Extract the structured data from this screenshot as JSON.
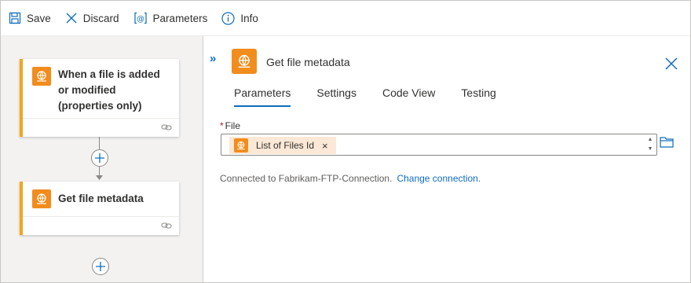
{
  "toolbar": {
    "save_label": "Save",
    "discard_label": "Discard",
    "parameters_label": "Parameters",
    "info_label": "Info"
  },
  "canvas": {
    "trigger_card": {
      "title": "When a file is added or modified (properties only)"
    },
    "action_card": {
      "title": "Get file metadata"
    }
  },
  "panel": {
    "title": "Get file metadata",
    "tabs": [
      {
        "label": "Parameters",
        "active": true
      },
      {
        "label": "Settings",
        "active": false
      },
      {
        "label": "Code View",
        "active": false
      },
      {
        "label": "Testing",
        "active": false
      }
    ],
    "file_field": {
      "label": "File",
      "required_marker": "*",
      "token": "List of Files Id",
      "token_remove": "×"
    },
    "connection": {
      "text": "Connected to Fabrikam-FTP-Connection.",
      "change_link": "Change connection."
    }
  },
  "colors": {
    "accent": "#0f6cbd",
    "connector_orange": "#f28c1c",
    "card_border": "#f2a51b",
    "token_bg": "#fce8d6"
  }
}
